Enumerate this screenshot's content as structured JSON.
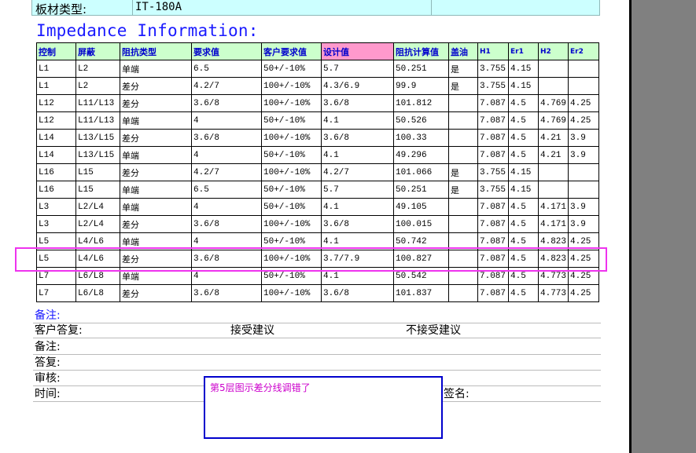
{
  "header_row": {
    "label": "板材类型:",
    "value": "IT-180A"
  },
  "title": "Impedance Information:",
  "columns": [
    "控制",
    "屏蔽",
    "阻抗类型",
    "要求值",
    "客户要求值",
    "设计值",
    "阻抗计算值",
    "盖油",
    "H1",
    "Er1",
    "H2",
    "Er2"
  ],
  "rows": [
    [
      "L1",
      "L2",
      "单端",
      "6.5",
      "50+/-10%",
      "5.7",
      "50.251",
      "是",
      "3.755",
      "4.15",
      "",
      ""
    ],
    [
      "L1",
      "L2",
      "差分",
      "4.2/7",
      "100+/-10%",
      "4.3/6.9",
      "99.9",
      "是",
      "3.755",
      "4.15",
      "",
      ""
    ],
    [
      "L12",
      "L11/L13",
      "差分",
      "3.6/8",
      "100+/-10%",
      "3.6/8",
      "101.812",
      "",
      "7.087",
      "4.5",
      "4.769",
      "4.25"
    ],
    [
      "L12",
      "L11/L13",
      "单端",
      "4",
      "50+/-10%",
      "4.1",
      "50.526",
      "",
      "7.087",
      "4.5",
      "4.769",
      "4.25"
    ],
    [
      "L14",
      "L13/L15",
      "差分",
      "3.6/8",
      "100+/-10%",
      "3.6/8",
      "100.33",
      "",
      "7.087",
      "4.5",
      "4.21",
      "3.9"
    ],
    [
      "L14",
      "L13/L15",
      "单端",
      "4",
      "50+/-10%",
      "4.1",
      "49.296",
      "",
      "7.087",
      "4.5",
      "4.21",
      "3.9"
    ],
    [
      "L16",
      "L15",
      "差分",
      "4.2/7",
      "100+/-10%",
      "4.2/7",
      "101.066",
      "是",
      "3.755",
      "4.15",
      "",
      ""
    ],
    [
      "L16",
      "L15",
      "单端",
      "6.5",
      "50+/-10%",
      "5.7",
      "50.251",
      "是",
      "3.755",
      "4.15",
      "",
      ""
    ],
    [
      "L3",
      "L2/L4",
      "单端",
      "4",
      "50+/-10%",
      "4.1",
      "49.105",
      "",
      "7.087",
      "4.5",
      "4.171",
      "3.9"
    ],
    [
      "L3",
      "L2/L4",
      "差分",
      "3.6/8",
      "100+/-10%",
      "3.6/8",
      "100.015",
      "",
      "7.087",
      "4.5",
      "4.171",
      "3.9"
    ],
    [
      "L5",
      "L4/L6",
      "单端",
      "4",
      "50+/-10%",
      "4.1",
      "50.742",
      "",
      "7.087",
      "4.5",
      "4.823",
      "4.25"
    ],
    [
      "L5",
      "L4/L6",
      "差分",
      "3.6/8",
      "100+/-10%",
      "3.7/7.9",
      "100.827",
      "",
      "7.087",
      "4.5",
      "4.823",
      "4.25"
    ],
    [
      "L7",
      "L6/L8",
      "单端",
      "4",
      "50+/-10%",
      "4.1",
      "50.542",
      "",
      "7.087",
      "4.5",
      "4.773",
      "4.25"
    ],
    [
      "L7",
      "L6/L8",
      "差分",
      "3.6/8",
      "100+/-10%",
      "3.6/8",
      "101.837",
      "",
      "7.087",
      "4.5",
      "4.773",
      "4.25"
    ]
  ],
  "notes": {
    "remark1": "备注:",
    "customer_reply": "客户答复:",
    "accept": "接受建议",
    "reject": "不接受建议",
    "remark2": "备注:",
    "reply": "答复:",
    "review": "审核:",
    "time": "时间:",
    "sign": "签名:"
  },
  "comment": "第5层图示差分线调错了",
  "colors": {
    "header_bg": "#ccffff",
    "col_header_bg": "#ccffcc",
    "design_header_bg": "#ff99cc",
    "title": "#1a1aff",
    "highlight": "#ee33ee",
    "comment_border": "#0000cc",
    "comment_text": "#cc00cc"
  }
}
